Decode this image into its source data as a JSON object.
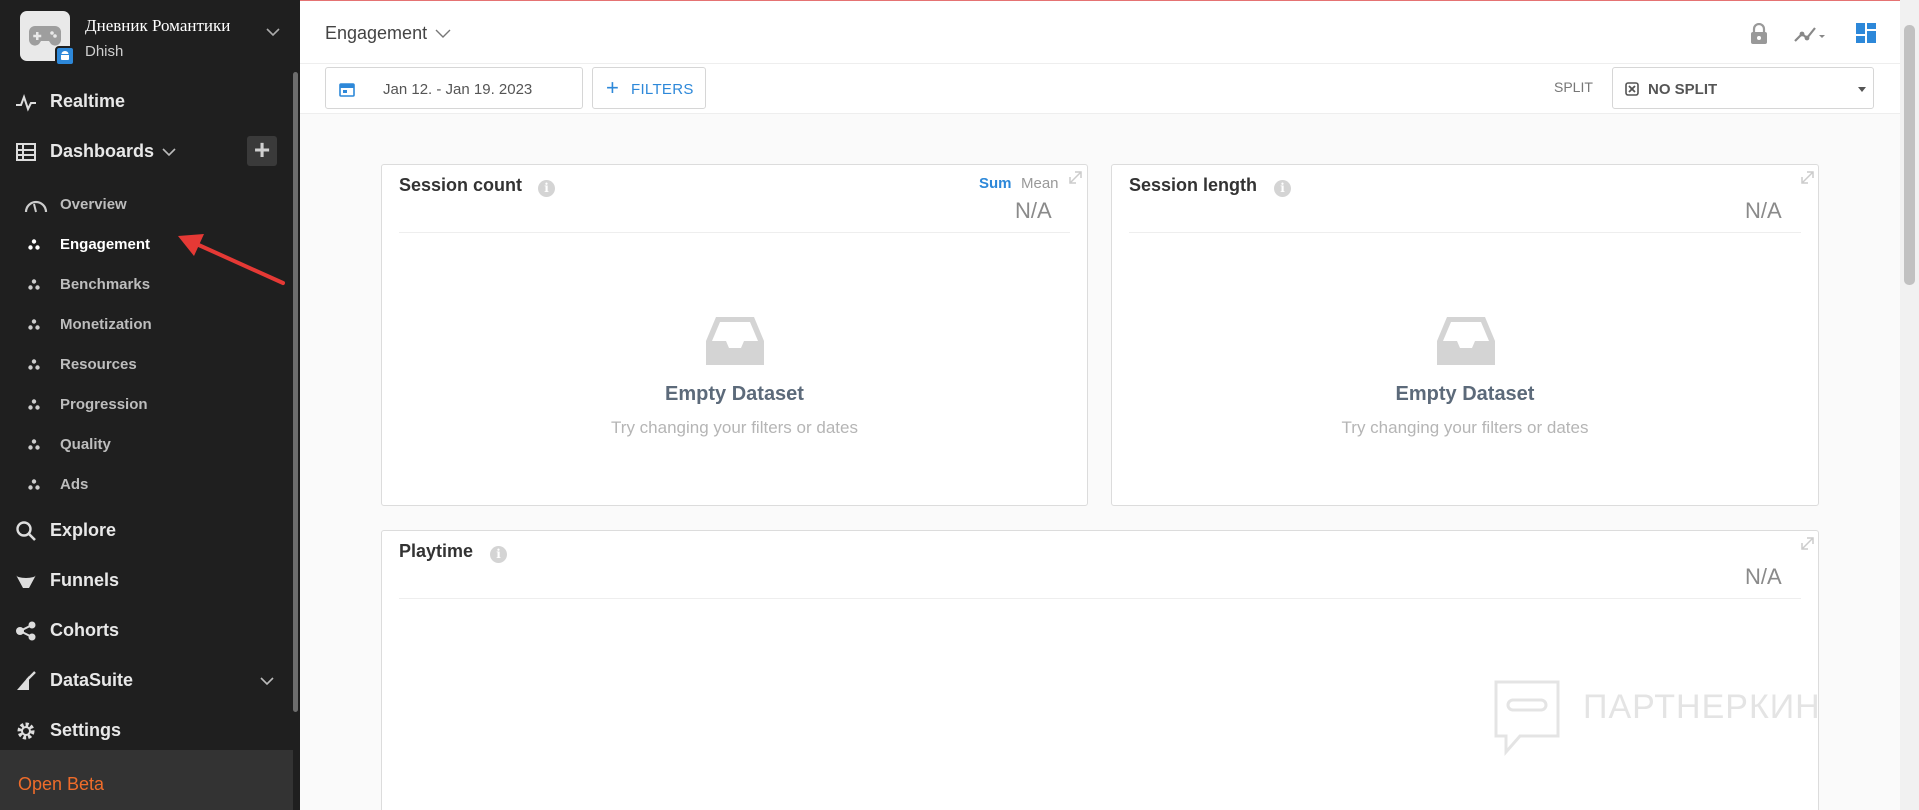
{
  "app": {
    "name": "Дневник Романтики",
    "studio": "Dhish"
  },
  "nav": {
    "realtime": "Realtime",
    "dashboards": "Dashboards",
    "add_label": "+",
    "sub": [
      {
        "label": "Overview",
        "active": false
      },
      {
        "label": "Engagement",
        "active": true
      },
      {
        "label": "Benchmarks",
        "active": false
      },
      {
        "label": "Monetization",
        "active": false
      },
      {
        "label": "Resources",
        "active": false
      },
      {
        "label": "Progression",
        "active": false
      },
      {
        "label": "Quality",
        "active": false
      },
      {
        "label": "Ads",
        "active": false
      }
    ],
    "explore": "Explore",
    "funnels": "Funnels",
    "cohorts": "Cohorts",
    "datasuite": "DataSuite",
    "settings": "Settings",
    "beta": "Open Beta"
  },
  "header": {
    "title": "Engagement"
  },
  "filters": {
    "date_range": "Jan 12. - Jan 19. 2023",
    "filters_label": "FILTERS",
    "split_label": "SPLIT",
    "split_value": "NO SPLIT"
  },
  "cards": {
    "session_count": {
      "title": "Session count",
      "agg_sum": "Sum",
      "agg_mean": "Mean",
      "value": "N/A",
      "empty_title": "Empty Dataset",
      "empty_sub": "Try changing your filters or dates"
    },
    "session_length": {
      "title": "Session length",
      "value": "N/A",
      "empty_title": "Empty Dataset",
      "empty_sub": "Try changing your filters or dates"
    },
    "playtime": {
      "title": "Playtime",
      "value": "N/A"
    }
  },
  "info_glyph": "i",
  "watermark": "ПАРТНЕРКИН",
  "colors": {
    "sidebar_bg": "#1f1f1f",
    "accent": "#2d88d9",
    "beta": "#ef6c2a",
    "annotation_arrow": "#e53935"
  }
}
